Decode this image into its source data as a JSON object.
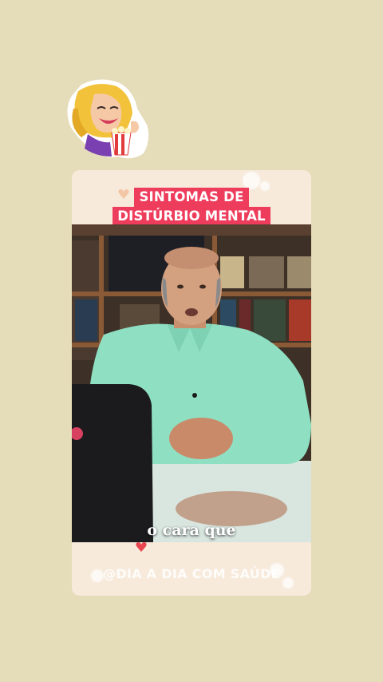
{
  "sticker": {
    "icon": "popcorn-woman-icon"
  },
  "card": {
    "title_line1": "SINTOMAS DE",
    "title_line2": "DISTÚRBIO MENTAL",
    "caption": "o cara que",
    "watermark": "@DIA A DIA COM SAÚDE"
  },
  "colors": {
    "background": "#e5dcb9",
    "card": "#f7eadb",
    "title_bg": "#ee3d5c",
    "shirt": "#8fe0c3"
  }
}
